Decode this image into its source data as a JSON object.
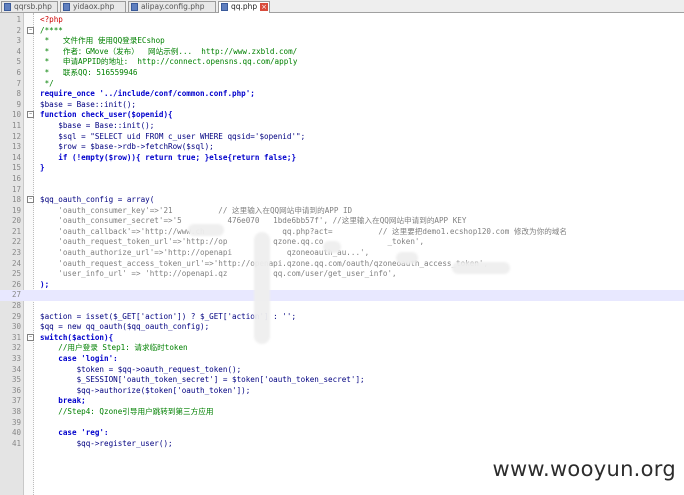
{
  "tabs": [
    {
      "label": "qqrsb.php"
    },
    {
      "label": "yidaox.php"
    },
    {
      "label": "alipay.config.php"
    },
    {
      "label": "qq.php"
    }
  ],
  "watermark": "www.wooyun.org",
  "lines": [
    {
      "n": "1",
      "code": "<?php"
    },
    {
      "n": "2",
      "code": "/****"
    },
    {
      "n": "3",
      "code": " *   文件作用 使用QQ登录ECshop"
    },
    {
      "n": "4",
      "code": " *   作者：GMove（发布）  网站示例...  http://www.zxbld.com/"
    },
    {
      "n": "5",
      "code": " *   申请APPID的地址:  http://connect.opensns.qq.com/apply"
    },
    {
      "n": "6",
      "code": " *   联系QQ: 516559946"
    },
    {
      "n": "7",
      "code": " */"
    },
    {
      "n": "8",
      "code": "require_once '../include/conf/common.conf.php';"
    },
    {
      "n": "9",
      "code": "$base = Base::init();"
    },
    {
      "n": "10",
      "code": "function check_user($openid){"
    },
    {
      "n": "11",
      "code": "    $base = Base::init();"
    },
    {
      "n": "12",
      "code": "    $sql = \"SELECT uid FROM c_user WHERE qqsid='$openid'\";"
    },
    {
      "n": "13",
      "code": "    $row = $base->rdb->fetchRow($sql);"
    },
    {
      "n": "14",
      "code": "    if (!empty($row)){ return true; }else{return false;}"
    },
    {
      "n": "15",
      "code": "}"
    },
    {
      "n": "16",
      "code": ""
    },
    {
      "n": "17",
      "code": ""
    },
    {
      "n": "18",
      "code": "$qq_oauth_config = array("
    },
    {
      "n": "19",
      "code": "    'oauth_consumer_key'=>'21          // 这里输入在QQ网站申请到的APP ID"
    },
    {
      "n": "20",
      "code": "    'oauth_consumer_secret'=>'5          476e070   1bde6bb57f', //这里输入在QQ网站申请到的APP KEY"
    },
    {
      "n": "21",
      "code": "    'oauth_callback'=>'http://www.ch                 qq.php?act=          // 这里要把demo1.ecshop120.com 修改为你的域名"
    },
    {
      "n": "22",
      "code": "    'oauth_request_token_url'=>'http://op          qzone.qq.co              _token',"
    },
    {
      "n": "23",
      "code": "    'oauth_authorize_url'=>'http://openapi            qzoneoauth_au...',"
    },
    {
      "n": "24",
      "code": "    'oauth_request_access_token_url'=>'http://openapi.qzone.qq.com/oauth/qzoneoauth_access_token',"
    },
    {
      "n": "25",
      "code": "    'user_info_url' => 'http://openapi.qz          qq.com/user/get_user_info',"
    },
    {
      "n": "26",
      "code": ");"
    },
    {
      "n": "27",
      "code": ""
    },
    {
      "n": "28",
      "code": ""
    },
    {
      "n": "29",
      "code": "$action = isset($_GET['action']) ? $_GET['action'] : '';"
    },
    {
      "n": "30",
      "code": "$qq = new qq_oauth($qq_oauth_config);"
    },
    {
      "n": "31",
      "code": "switch($action){"
    },
    {
      "n": "32",
      "code": "    //用户登录 Step1: 请求临时token"
    },
    {
      "n": "33",
      "code": "    case 'login':"
    },
    {
      "n": "34",
      "code": "        $token = $qq->oauth_request_token();"
    },
    {
      "n": "35",
      "code": "        $_SESSION['oauth_token_secret'] = $token['oauth_token_secret'];"
    },
    {
      "n": "36",
      "code": "        $qq->authorize($token['oauth_token']);"
    },
    {
      "n": "37",
      "code": "    break;"
    },
    {
      "n": "38",
      "code": "    //Step4: Qzone引导用户跳转到第三方应用"
    },
    {
      "n": "39",
      "code": ""
    },
    {
      "n": "40",
      "code": "    case 'reg':"
    },
    {
      "n": "41",
      "code": "        $qq->register_user();"
    }
  ]
}
